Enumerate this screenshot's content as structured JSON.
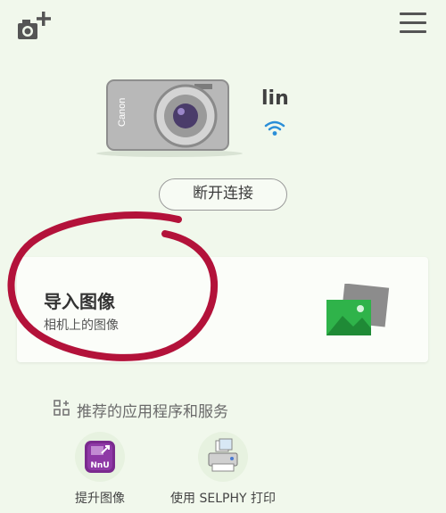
{
  "header": {
    "add_camera_icon": "camera-plus-icon",
    "menu_icon": "hamburger-menu-icon"
  },
  "device": {
    "name": "lin",
    "connection_icon": "wifi-icon",
    "wifi_color": "#2a8ed8"
  },
  "actions": {
    "disconnect_label": "断开连接"
  },
  "import_card": {
    "title": "导入图像",
    "subtitle": "相机上的图像",
    "icon": "gallery-icon"
  },
  "services": {
    "title": "推荐的应用程序和服务",
    "items": [
      {
        "label": "提升图像",
        "icon": "image-enhance-app-icon",
        "badge_text": "NnU"
      },
      {
        "label": "使用 SELPHY 打印",
        "icon": "selphy-printer-icon"
      }
    ]
  },
  "colors": {
    "background": "#f1f8ec",
    "annotation": "#b3123a",
    "gallery_green": "#2fb34a"
  }
}
